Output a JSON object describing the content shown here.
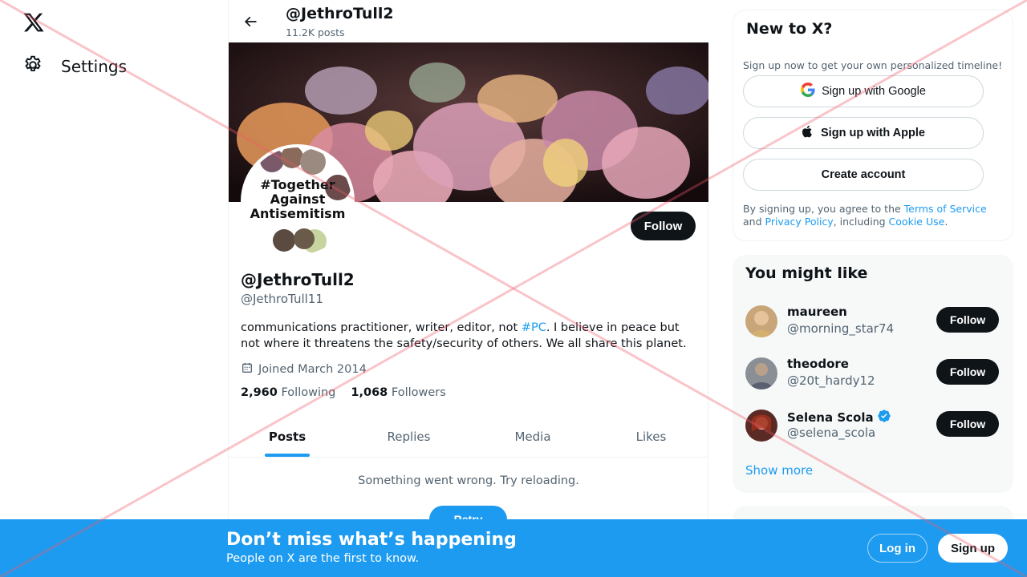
{
  "nav": {
    "logo_icon": "x-logo-icon",
    "settings_label": "Settings"
  },
  "profile": {
    "top_name": "@JethroTull2",
    "posts_count": "11.2K posts",
    "avatar_text": [
      "#Together",
      "Against",
      "Antisemitism"
    ],
    "follow_label": "Follow",
    "name": "@JethroTull2",
    "handle": "@JethroTull11",
    "bio_before": "communications practitioner, writer, editor,  not ",
    "bio_tag": "#PC",
    "bio_after": ". I believe in peace but not where it threatens the safety/security of others. We all share this planet.",
    "joined": "Joined March 2014",
    "following_count": "2,960",
    "following_label": "Following",
    "followers_count": "1,068",
    "followers_label": "Followers"
  },
  "tabs": [
    {
      "label": "Posts",
      "active": true
    },
    {
      "label": "Replies",
      "active": false
    },
    {
      "label": "Media",
      "active": false
    },
    {
      "label": "Likes",
      "active": false
    }
  ],
  "feed": {
    "error_text": "Something went wrong. Try reloading.",
    "retry_label": "Retry"
  },
  "new_to_x": {
    "title": "New to X?",
    "subtitle": "Sign up now to get your own personalized timeline!",
    "google_label": "Sign up with Google",
    "apple_label": "Sign up with Apple",
    "create_label": "Create account",
    "legal_1": "By signing up, you agree to the ",
    "terms": "Terms of Service",
    "legal_2": " and ",
    "privacy": "Privacy Policy",
    "legal_3": ", including ",
    "cookie": "Cookie Use",
    "legal_4": "."
  },
  "might_like": {
    "title": "You might like",
    "users": [
      {
        "name": "maureen",
        "handle": "@morning_star74",
        "verified": false,
        "follow_label": "Follow"
      },
      {
        "name": "theodore",
        "handle": "@20t_hardy12",
        "verified": false,
        "follow_label": "Follow"
      },
      {
        "name": "Selena Scola",
        "handle": "@selena_scola",
        "verified": true,
        "follow_label": "Follow"
      }
    ],
    "show_more": "Show more"
  },
  "bottom_bar": {
    "title": "Don’t miss what’s happening",
    "subtitle": "People on X are the first to know.",
    "login_label": "Log in",
    "signup_label": "Sign up"
  },
  "colors": {
    "accent": "#1d9bf0",
    "dark": "#0f1419",
    "muted": "#536471",
    "overlay_cross": "#f05a6a"
  }
}
